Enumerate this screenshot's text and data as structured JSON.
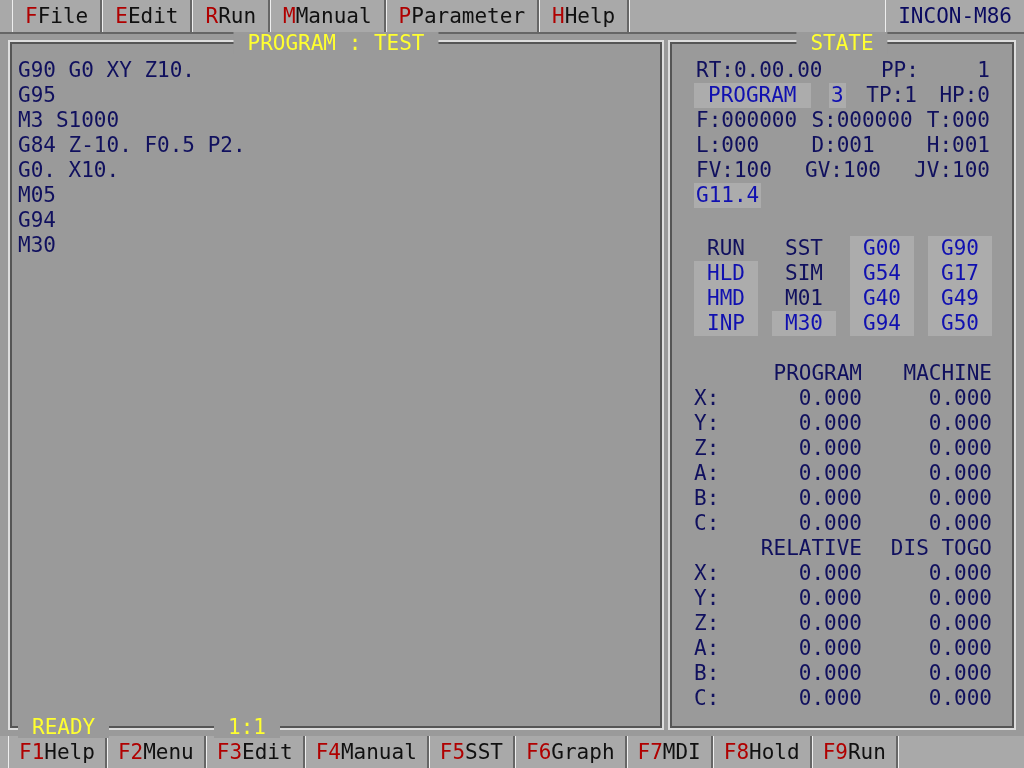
{
  "menu": [
    {
      "key": "F",
      "label": "File"
    },
    {
      "key": "E",
      "label": "Edit"
    },
    {
      "key": "R",
      "label": "Run"
    },
    {
      "key": "M",
      "label": "Manual"
    },
    {
      "key": "P",
      "label": "Parameter"
    },
    {
      "key": "H",
      "label": "Help"
    }
  ],
  "product": "INCON-M86",
  "program_panel": {
    "title": "PROGRAM : TEST",
    "lines": [
      "G90 G0 XY Z10.",
      "G95",
      "M3 S1000",
      "G84 Z-10. F0.5 P2.",
      "G0. X10.",
      "M05",
      "G94",
      "M30"
    ],
    "status": "READY",
    "position": "1:1"
  },
  "state_panel": {
    "title": "STATE",
    "rows": [
      [
        {
          "text": "RT:0.00.00",
          "on": false
        },
        {
          "text": "PP:",
          "on": false
        },
        {
          "text": "1",
          "on": false
        }
      ],
      [
        {
          "text": "PROGRAM",
          "on": true
        },
        {
          "text": "3",
          "on": true
        },
        {
          "text": "TP:1",
          "on": false
        },
        {
          "text": "HP:0",
          "on": false
        }
      ],
      [
        {
          "text": "F:000000",
          "on": false
        },
        {
          "text": "S:000000",
          "on": false
        },
        {
          "text": "T:000",
          "on": false
        }
      ],
      [
        {
          "text": "L:000",
          "on": false
        },
        {
          "text": "D:001",
          "on": false
        },
        {
          "text": "H:001",
          "on": false
        }
      ],
      [
        {
          "text": "FV:100",
          "on": false
        },
        {
          "text": "GV:100",
          "on": false
        },
        {
          "text": "JV:100",
          "on": false
        }
      ],
      [
        {
          "text": "G11.4",
          "on": true
        }
      ]
    ],
    "modes": [
      [
        {
          "text": "RUN",
          "on": false
        },
        {
          "text": "HLD",
          "on": true
        },
        {
          "text": "HMD",
          "on": true
        },
        {
          "text": "INP",
          "on": true
        }
      ],
      [
        {
          "text": "SST",
          "on": false
        },
        {
          "text": "SIM",
          "on": false
        },
        {
          "text": "M01",
          "on": false
        },
        {
          "text": "M30",
          "on": true
        }
      ],
      [
        {
          "text": "G00",
          "on": true
        },
        {
          "text": "G54",
          "on": true
        },
        {
          "text": "G40",
          "on": true
        },
        {
          "text": "G94",
          "on": true
        }
      ],
      [
        {
          "text": "G90",
          "on": true
        },
        {
          "text": "G17",
          "on": true
        },
        {
          "text": "G49",
          "on": true
        },
        {
          "text": "G50",
          "on": true
        }
      ]
    ],
    "coordinates": [
      {
        "headers": [
          "PROGRAM",
          "MACHINE"
        ],
        "rows": [
          [
            "X:",
            "0.000",
            "0.000"
          ],
          [
            "Y:",
            "0.000",
            "0.000"
          ],
          [
            "Z:",
            "0.000",
            "0.000"
          ],
          [
            "A:",
            "0.000",
            "0.000"
          ],
          [
            "B:",
            "0.000",
            "0.000"
          ],
          [
            "C:",
            "0.000",
            "0.000"
          ]
        ]
      },
      {
        "headers": [
          "RELATIVE",
          "DIS TOGO"
        ],
        "rows": [
          [
            "X:",
            "0.000",
            "0.000"
          ],
          [
            "Y:",
            "0.000",
            "0.000"
          ],
          [
            "Z:",
            "0.000",
            "0.000"
          ],
          [
            "A:",
            "0.000",
            "0.000"
          ],
          [
            "B:",
            "0.000",
            "0.000"
          ],
          [
            "C:",
            "0.000",
            "0.000"
          ]
        ]
      }
    ]
  },
  "function_keys": [
    {
      "key": "F1",
      "label": "Help"
    },
    {
      "key": "F2",
      "label": "Menu"
    },
    {
      "key": "F3",
      "label": "Edit"
    },
    {
      "key": "F4",
      "label": "Manual"
    },
    {
      "key": "F5",
      "label": "SST"
    },
    {
      "key": "F6",
      "label": "Graph"
    },
    {
      "key": "F7",
      "label": "MDI"
    },
    {
      "key": "F8",
      "label": "Hold"
    },
    {
      "key": "F9",
      "label": "Run"
    }
  ]
}
